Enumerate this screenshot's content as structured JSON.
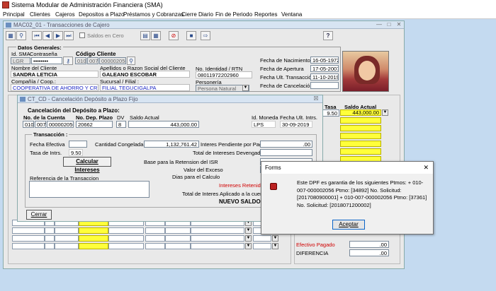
{
  "app": {
    "title": "Sistema Modular de Administración Financiera (SMA)"
  },
  "menu": [
    "Principal",
    "Clientes",
    "Cajeros",
    "Depositos a Plazo",
    "Préstamos y Cobranzas",
    "Cierre Diario",
    "Fin de Periodo",
    "Reportes",
    "Ventana"
  ],
  "main_window": {
    "title": "MAC02_01 - Transacciones de Cajero",
    "toolbar": {
      "saldos_cero": "Saldos en Cero",
      "help": "?"
    },
    "datos_generales": {
      "header": "Datos Generales:",
      "id_sma_label": "Id. SMA",
      "contrasena_label": "Contraseña",
      "id_sma_value": "LGR",
      "contrasena_value": "••••••••",
      "codigo_cliente_label": "Código Cliente",
      "codigo_1": "010",
      "codigo_2": "007",
      "codigo_3": "000002056",
      "nombre_label": "Nombre del Cliente",
      "nombre_value": "SANDRA LETICIA",
      "apellidos_label": "Apellidos o Razon Social del Cliente",
      "apellidos_value": "GALEANO ESCOBAR",
      "identidad_label": "No. Identidad / RTN",
      "identidad_value": "08011972202960",
      "compania_label": "Compañía / Coop.:",
      "compania_value": "COOPERATIVA DE AHORRO Y CRÉDITO",
      "sucursal_label": "Sucursal / Filial :",
      "sucursal_value": "FILIAL TEGUCIGALPA",
      "personeria_label": "Personería",
      "personeria_value": "Persona Natural",
      "fecha_nacimiento_label": "Fecha de Nacimiento",
      "fecha_nacimiento_value": "16-05-1972",
      "fecha_apertura_label": "Fecha de  Apertura",
      "fecha_apertura_value": "17-05-2007",
      "fecha_ult_label": "Fecha Ult. Transacción",
      "fecha_ult_value": "11-10-2019",
      "fecha_cancel_label": "Fecha de Cancelación"
    },
    "right_grid": {
      "tasa_header": "Tasa",
      "saldo_header": "Saldo Actual",
      "row1_tasa": "9.50",
      "row1_saldo": "443,000.00"
    },
    "totals": {
      "efectivo_label": "Efectivo Pagado",
      "efectivo_value": ".00",
      "diferencia_label": "DIFERENCIA",
      "diferencia_value": ".00"
    }
  },
  "cancel_window": {
    "title": "CT_CD - Cancelación Depósito a Plazo Fijo",
    "close": "☒",
    "header": "Cancelación del Depósito a Plazo:",
    "no_cuenta_label": "No. de la Cuenta",
    "no_dep_label": "No. Dep. Plazo",
    "dv_label": "DV",
    "saldo_actual_label": "Saldo Actual",
    "moneda_label": "Id. Moneda",
    "fecha_ult_label": "Fecha Ult. Intrs.",
    "cuenta_1": "010",
    "cuenta_2": "007",
    "cuenta_3": "000002056",
    "no_dep_value": "20662",
    "dv_value": "8",
    "saldo_value": "443,000.00",
    "moneda_value": "LPS",
    "fecha_ult_value": "30-09-2019",
    "transaccion_header": "Transacción :",
    "fecha_efectiva_label": "Fecha Efectiva",
    "cantidad_congelada_label": "Cantidad Congelada",
    "cantidad_congelada_value": "1,132,761.42",
    "interes_pendiente_label": "Interes Pendiente por Pagar",
    "interes_pendiente_value": ".00",
    "tasa_label": "Tasa de Intrs.",
    "tasa_value": "9.50",
    "total_devengados_label": "Total de Intereses Devengados",
    "calcular_button": "Calcular Intereses",
    "base_isr_label": "Base para la Retension del ISR",
    "valor_exceso_label": "Valor del Exceso",
    "dias_label": "Dias para el Calculo",
    "referencia_label": "Referencia de la Transaccion",
    "intereses_retenido_label": "Intereses Retenido",
    "total_aplicado_label": "Total de Interes Aplicado a la cuenta",
    "nuevo_saldo_label": "NUEVO SALDO",
    "cerrar_button": "Cerrar"
  },
  "dialog": {
    "title": "Forms",
    "close": "✕",
    "message": "Este DPF es garantia de los siguientes Ptmos:  + 010-007-000002056 Ptmo: [34892] No. Solicitud: [2017080900001] + 010-007-000002056 Ptmo: [37361] No. Solicitud: [2018071200002]",
    "accept_button": "Aceptar"
  },
  "colors": {
    "workspace": "#c4daf0",
    "yellow_field": "#ffff3a",
    "red_label": "#d00000",
    "blue_text": "#1a24c4"
  }
}
